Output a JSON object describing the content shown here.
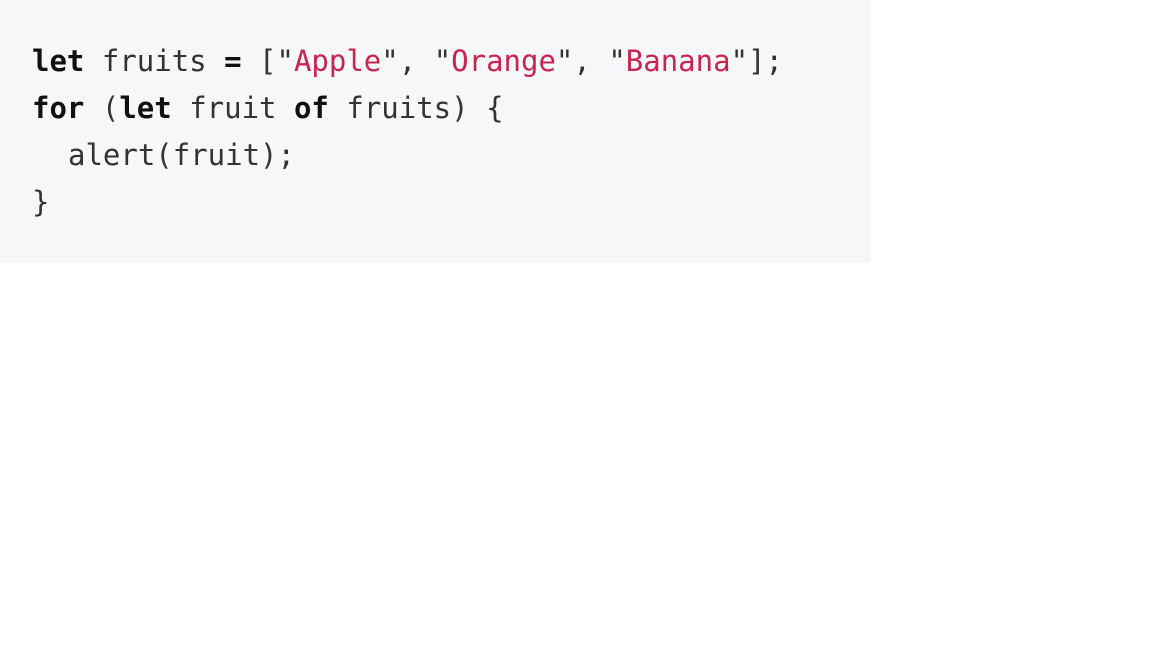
{
  "code_block": {
    "line1": {
      "kw_let": "let",
      "ident_fruits": "fruits",
      "op_assign": "=",
      "open_bracket": "[",
      "q1o": "\"",
      "str_apple": "Apple",
      "q1c": "\"",
      "comma1": ",",
      "q2o": "\"",
      "str_orange": "Orange",
      "q2c": "\"",
      "comma2": ",",
      "q3o": "\"",
      "str_banana": "Banana",
      "q3c": "\"",
      "close_bracket_semi": "];"
    },
    "line2": {
      "kw_for": "for",
      "open_paren": "(",
      "kw_let": "let",
      "ident_fruit": "fruit",
      "kw_of": "of",
      "ident_fruits": "fruits",
      "close_paren": ")",
      "open_brace": "{"
    },
    "line3": {
      "call": "alert(fruit);"
    },
    "line4": {
      "close_brace": "}"
    }
  }
}
